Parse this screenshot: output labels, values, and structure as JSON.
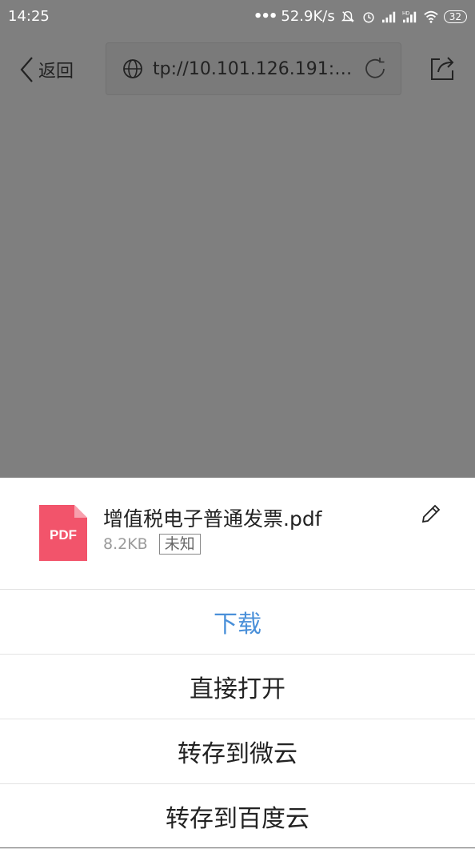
{
  "status_bar": {
    "time": "14:25",
    "dots": "•••",
    "net_speed": "52.9K/s",
    "battery": "32"
  },
  "nav": {
    "back_label": "返回",
    "url": "tp://10.101.126.191:1..."
  },
  "file": {
    "icon_label": "PDF",
    "name": "增值税电子普通发票.pdf",
    "size": "8.2KB",
    "tag": "未知",
    "icon_color": "#f2546b"
  },
  "actions": [
    {
      "label": "下载"
    },
    {
      "label": "直接打开"
    },
    {
      "label": "转存到微云"
    },
    {
      "label": "转存到百度云"
    }
  ],
  "colors": {
    "overlay": "#7f7f7f",
    "primary_action": "#4a90d9"
  }
}
